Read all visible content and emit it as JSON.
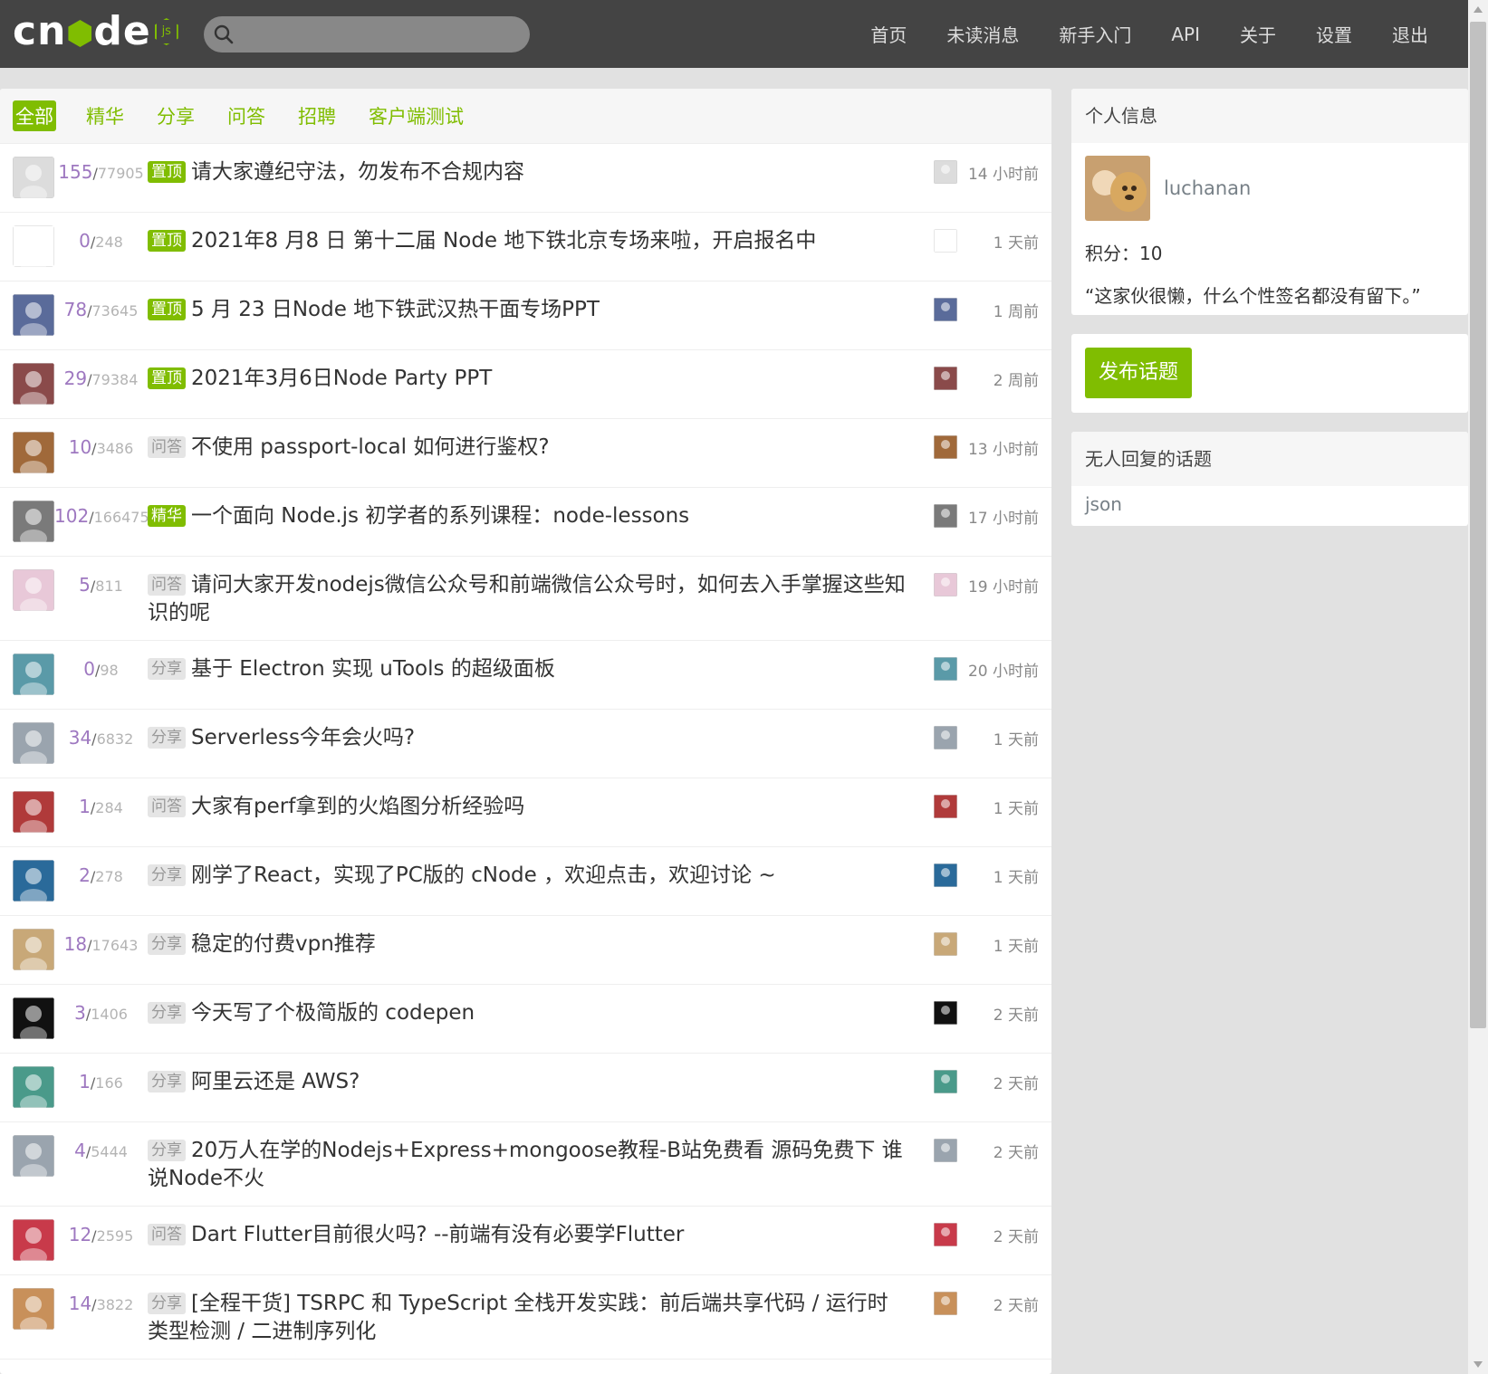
{
  "header": {
    "logo_text": "cnode",
    "logo_badge": "js",
    "search_placeholder": "",
    "nav": [
      "首页",
      "未读消息",
      "新手入门",
      "API",
      "关于",
      "设置",
      "退出"
    ]
  },
  "tabs": [
    {
      "label": "全部",
      "active": true
    },
    {
      "label": "精华",
      "active": false
    },
    {
      "label": "分享",
      "active": false
    },
    {
      "label": "问答",
      "active": false
    },
    {
      "label": "招聘",
      "active": false
    },
    {
      "label": "客户端测试",
      "active": false
    }
  ],
  "topics": [
    {
      "reply": "155",
      "visit": "77905",
      "badge": "置顶",
      "badge_type": "top",
      "title": "请大家遵纪守法，勿发布不合规内容",
      "time": "14 小时前",
      "color": "#dcdcdc"
    },
    {
      "reply": "0",
      "visit": "248",
      "badge": "置顶",
      "badge_type": "top",
      "title": "2021年8 月8 日 第十二届 Node 地下铁北京专场来啦，开启报名中",
      "time": "1 天前",
      "color": "#ffffff"
    },
    {
      "reply": "78",
      "visit": "73645",
      "badge": "置顶",
      "badge_type": "top",
      "title": "5 月 23 日Node 地下铁武汉热干面专场PPT",
      "time": "1 周前",
      "color": "#5a6b9a"
    },
    {
      "reply": "29",
      "visit": "79384",
      "badge": "置顶",
      "badge_type": "top",
      "title": "2021年3月6日Node Party PPT",
      "time": "2 周前",
      "color": "#8a4a4a"
    },
    {
      "reply": "10",
      "visit": "3486",
      "badge": "问答",
      "badge_type": "plain",
      "title": "不使用 passport-local 如何进行鉴权?",
      "time": "13 小时前",
      "color": "#a0693a"
    },
    {
      "reply": "102",
      "visit": "166475",
      "badge": "精华",
      "badge_type": "top",
      "title": "一个面向 Node.js 初学者的系列课程：node-lessons",
      "time": "17 小时前",
      "color": "#7a7a7a"
    },
    {
      "reply": "5",
      "visit": "811",
      "badge": "问答",
      "badge_type": "plain",
      "title": "请问大家开发nodejs微信公众号和前端微信公众号时，如何去入手掌握这些知识的呢",
      "time": "19 小时前",
      "color": "#e8c8d8"
    },
    {
      "reply": "0",
      "visit": "98",
      "badge": "分享",
      "badge_type": "plain",
      "title": "基于 Electron 实现 uTools 的超级面板",
      "time": "20 小时前",
      "color": "#5a9aa8"
    },
    {
      "reply": "34",
      "visit": "6832",
      "badge": "分享",
      "badge_type": "plain",
      "title": "Serverless今年会火吗?",
      "time": "1 天前",
      "color": "#9aa4ae"
    },
    {
      "reply": "1",
      "visit": "284",
      "badge": "问答",
      "badge_type": "plain",
      "title": "大家有perf拿到的火焰图分析经验吗",
      "time": "1 天前",
      "color": "#b03a3a"
    },
    {
      "reply": "2",
      "visit": "278",
      "badge": "分享",
      "badge_type": "plain",
      "title": "刚学了React，实现了PC版的 cNode ，欢迎点击，欢迎讨论 ~",
      "time": "1 天前",
      "color": "#2a6a9a"
    },
    {
      "reply": "18",
      "visit": "17643",
      "badge": "分享",
      "badge_type": "plain",
      "title": "稳定的付费vpn推荐",
      "time": "1 天前",
      "color": "#c8a878"
    },
    {
      "reply": "3",
      "visit": "1406",
      "badge": "分享",
      "badge_type": "plain",
      "title": "今天写了个极简版的 codepen",
      "time": "2 天前",
      "color": "#111111"
    },
    {
      "reply": "1",
      "visit": "166",
      "badge": "分享",
      "badge_type": "plain",
      "title": "阿里云还是 AWS?",
      "time": "2 天前",
      "color": "#4a9a8a"
    },
    {
      "reply": "4",
      "visit": "5444",
      "badge": "分享",
      "badge_type": "plain",
      "title": "20万人在学的Nodejs+Express+mongoose教程-B站免费看 源码免费下 谁说Node不火",
      "time": "2 天前",
      "color": "#9aa4ae"
    },
    {
      "reply": "12",
      "visit": "2595",
      "badge": "问答",
      "badge_type": "plain",
      "title": "Dart Flutter目前很火吗? --前端有没有必要学Flutter",
      "time": "2 天前",
      "color": "#c83a4a"
    },
    {
      "reply": "14",
      "visit": "3822",
      "badge": "分享",
      "badge_type": "plain",
      "title": "[全程干货] TSRPC 和 TypeScript 全栈开发实践：前后端共享代码 / 运行时类型检测 / 二进制序列化",
      "time": "2 天前",
      "color": "#c8905a"
    }
  ],
  "sidebar": {
    "profile_header": "个人信息",
    "username": "luchanan",
    "score_label": "积分：",
    "score": "10",
    "motto": "“这家伙很懒，什么个性签名都没有留下。”",
    "publish_label": "发布话题",
    "no_reply_header": "无人回复的话题",
    "no_reply_items": [
      "json"
    ]
  },
  "colors": {
    "accent": "#80bd01",
    "header_bg": "#444444"
  }
}
